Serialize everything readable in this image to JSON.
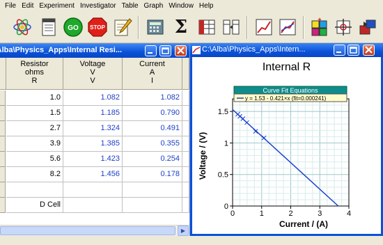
{
  "menu": [
    "File",
    "Edit",
    "Experiment",
    "Investigator",
    "Table",
    "Graph",
    "Window",
    "Help"
  ],
  "toolbar": {
    "icons": [
      "atom-icon",
      "notebook-icon",
      "go-icon",
      "stop-icon",
      "pencil-note-icon",
      "calculator-icon",
      "sigma-icon",
      "table-icon",
      "column-split-icon",
      "graph-icon",
      "graph-fit-icon",
      "grid-add-icon",
      "crosshair-icon",
      "export-icon"
    ],
    "go_label": "GO",
    "stop_label": "STOP",
    "sigma_label": "Σ"
  },
  "table_window": {
    "title": "C:\\Alba\\Physics_Apps\\Internal Resi...",
    "columns": [
      {
        "name": "Resistor",
        "unit_line": "ohms",
        "symbol": "R"
      },
      {
        "name": "Voltage",
        "unit_line": "V",
        "symbol": "V"
      },
      {
        "name": "Current",
        "unit_line": "A",
        "symbol": "I"
      }
    ],
    "rows": [
      [
        "1.0",
        "1.082",
        "1.082"
      ],
      [
        "1.5",
        "1.185",
        "0.790"
      ],
      [
        "2.7",
        "1.324",
        "0.491"
      ],
      [
        "3.9",
        "1.385",
        "0.355"
      ],
      [
        "5.6",
        "1.423",
        "0.254"
      ],
      [
        "8.2",
        "1.456",
        "0.178"
      ],
      [
        "",
        "",
        ""
      ],
      [
        "D Cell",
        "",
        ""
      ]
    ]
  },
  "graph_window": {
    "title": "C:\\Alba\\Physics_Apps\\Intern...",
    "graph_title": "Internal R",
    "legend_title": "Curve Fit Equations",
    "fit_equation": "y = 1.53 - 0.421×x (fit=0.000241)",
    "y_axis_label": "Voltage / (V)",
    "x_axis_label": "Current / (A)",
    "x_ticks": [
      "0",
      "1",
      "2",
      "3",
      "4"
    ],
    "y_ticks": [
      "0",
      "0.5",
      "1",
      "1.5"
    ],
    "accent": "#1a3fd0"
  },
  "chart_data": {
    "type": "scatter",
    "title": "Internal R",
    "xlabel": "Current / (A)",
    "ylabel": "Voltage / (V)",
    "xlim": [
      0,
      4
    ],
    "ylim": [
      0,
      1.7
    ],
    "series": [
      {
        "x": [
          1.082,
          0.79,
          0.491,
          0.355,
          0.254,
          0.178
        ],
        "y": [
          1.082,
          1.185,
          1.324,
          1.385,
          1.423,
          1.456
        ]
      }
    ],
    "fit": {
      "intercept": 1.53,
      "slope": -0.421
    }
  }
}
